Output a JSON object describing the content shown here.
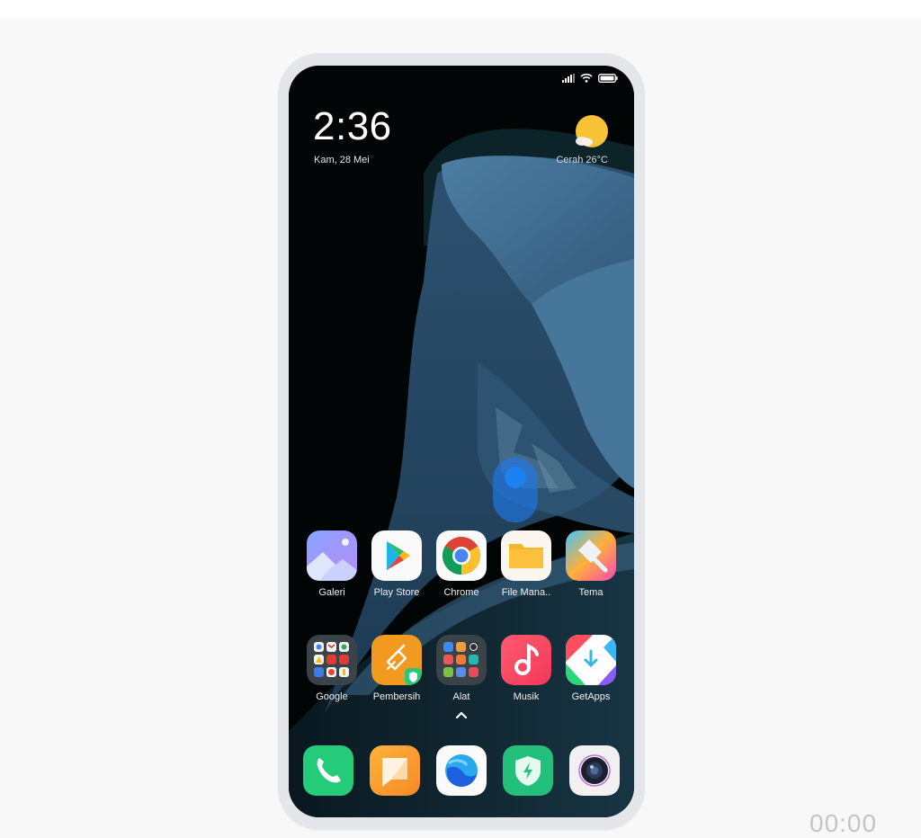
{
  "status_bar": {
    "icons": [
      "signal-icon",
      "wifi-icon",
      "battery-icon"
    ]
  },
  "clock_widget": {
    "time": "2:36",
    "date": "Kam, 28 Mei"
  },
  "weather_widget": {
    "condition": "Cerah",
    "temperature": "26°C",
    "text": "Cerah  26°C",
    "icon": "sun-cloud-icon"
  },
  "home_screen": {
    "row1": [
      {
        "label": "Galeri",
        "icon": "gallery-icon"
      },
      {
        "label": "Play Store",
        "icon": "play-store-icon"
      },
      {
        "label": "Chrome",
        "icon": "chrome-icon"
      },
      {
        "label": "File Mana..",
        "icon": "file-manager-icon"
      },
      {
        "label": "Tema",
        "icon": "themes-icon"
      }
    ],
    "row2": [
      {
        "label": "Google",
        "icon": "google-folder-icon"
      },
      {
        "label": "Pembersih",
        "icon": "cleaner-icon"
      },
      {
        "label": "Alat",
        "icon": "tools-folder-icon"
      },
      {
        "label": "Musik",
        "icon": "music-icon"
      },
      {
        "label": "GetApps",
        "icon": "getapps-icon"
      }
    ],
    "app_drawer_hint": "chevron-up-icon"
  },
  "dock": [
    {
      "name": "Phone",
      "icon": "phone-icon"
    },
    {
      "name": "Messages",
      "icon": "messages-icon"
    },
    {
      "name": "Browser",
      "icon": "browser-icon"
    },
    {
      "name": "Security",
      "icon": "security-icon"
    },
    {
      "name": "Camera",
      "icon": "camera-icon"
    }
  ],
  "recording_timer": "00:00",
  "colors": {
    "page_background": "#f8f8f8",
    "phone_bezel": "#e4e6ea",
    "wallpaper_dark": "#020506",
    "wallpaper_blue": "#3f6b8c",
    "touch_indicator": "#1b82f0",
    "timer_text": "#c4c4c4"
  }
}
